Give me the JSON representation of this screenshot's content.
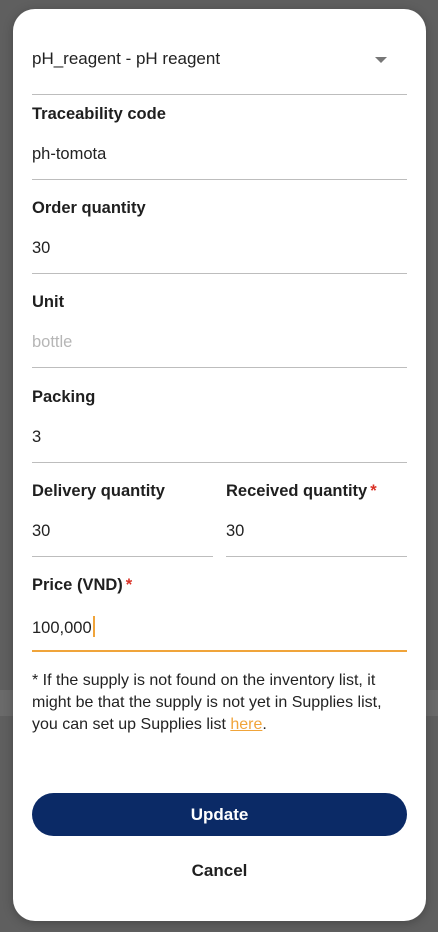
{
  "supply_select": {
    "value": "pH_reagent - pH reagent"
  },
  "fields": {
    "traceability": {
      "label": "Traceability code",
      "value": "ph-tomota"
    },
    "order_quantity": {
      "label": "Order quantity",
      "value": "30"
    },
    "unit": {
      "label": "Unit",
      "placeholder": "bottle"
    },
    "packing": {
      "label": "Packing",
      "value": "3"
    },
    "delivery_quantity": {
      "label": "Delivery quantity",
      "value": "30"
    },
    "received_quantity": {
      "label": "Received quantity",
      "required_mark": "*",
      "value": "30"
    },
    "price": {
      "label": "Price (VND)",
      "required_mark": "*",
      "value": "100,000"
    }
  },
  "note": {
    "text": "* If the supply is not found on the inventory list, it might be that the supply is not yet in Supplies list, you can set up Supplies list ",
    "link": "here",
    "end": "."
  },
  "buttons": {
    "update": "Update",
    "cancel": "Cancel"
  },
  "colors": {
    "primary": "#0b2a66",
    "accent": "#f0a43a",
    "required": "#d93025"
  }
}
